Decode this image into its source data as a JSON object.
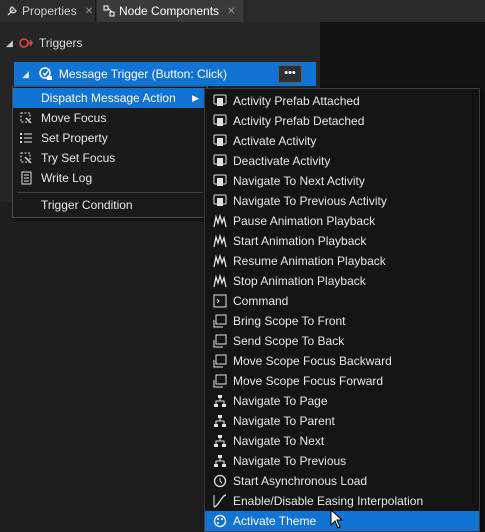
{
  "tabs": [
    {
      "label": "Properties",
      "icon": "wrench-icon"
    },
    {
      "label": "Node Components",
      "icon": "components-icon"
    }
  ],
  "tab_close_glyph": "✕",
  "triggers": {
    "label": "Triggers",
    "icon": "trigger-icon"
  },
  "message_trigger": {
    "label": "Message Trigger (Button: Click)",
    "icon": "message-trigger-icon",
    "more_label": "•••"
  },
  "context_menu": {
    "items": [
      {
        "label": "Dispatch Message Action",
        "icon": "",
        "highlighted": true,
        "has_submenu": true
      },
      {
        "label": "Move Focus",
        "icon": "move-focus-icon"
      },
      {
        "label": "Set Property",
        "icon": "set-property-icon"
      },
      {
        "label": "Try Set Focus",
        "icon": "try-set-focus-icon"
      },
      {
        "label": "Write Log",
        "icon": "write-log-icon"
      },
      {
        "label": "Trigger Condition",
        "icon": ""
      }
    ]
  },
  "submenu": {
    "items": [
      {
        "label": "Activity Prefab Attached",
        "icon": "activity-icon"
      },
      {
        "label": "Activity Prefab Detached",
        "icon": "activity-icon"
      },
      {
        "label": "Activate Activity",
        "icon": "activity-icon"
      },
      {
        "label": "Deactivate Activity",
        "icon": "activity-icon"
      },
      {
        "label": "Navigate To Next Activity",
        "icon": "activity-icon"
      },
      {
        "label": "Navigate To Previous Activity",
        "icon": "activity-icon"
      },
      {
        "label": "Pause Animation Playback",
        "icon": "animation-icon"
      },
      {
        "label": "Start Animation Playback",
        "icon": "animation-icon"
      },
      {
        "label": "Resume Animation Playback",
        "icon": "animation-icon"
      },
      {
        "label": "Stop Animation Playback",
        "icon": "animation-icon"
      },
      {
        "label": "Command",
        "icon": "command-icon"
      },
      {
        "label": "Bring Scope To Front",
        "icon": "scope-icon"
      },
      {
        "label": "Send Scope To Back",
        "icon": "scope-icon"
      },
      {
        "label": "Move Scope Focus Backward",
        "icon": "scope-icon"
      },
      {
        "label": "Move Scope Focus Forward",
        "icon": "scope-icon"
      },
      {
        "label": "Navigate To Page",
        "icon": "page-nav-icon"
      },
      {
        "label": "Navigate To Parent",
        "icon": "page-nav-icon"
      },
      {
        "label": "Navigate To Next",
        "icon": "page-nav-icon"
      },
      {
        "label": "Navigate To Previous",
        "icon": "page-nav-icon"
      },
      {
        "label": "Start Asynchronous Load",
        "icon": "async-load-icon"
      },
      {
        "label": "Enable/Disable Easing Interpolation",
        "icon": "easing-icon"
      },
      {
        "label": "Activate Theme",
        "icon": "theme-icon",
        "highlighted": true
      }
    ]
  },
  "colors": {
    "highlight": "#1173d4",
    "background": "#1e1e1e",
    "menu_bg": "#141414",
    "text": "#e8e8e8"
  }
}
